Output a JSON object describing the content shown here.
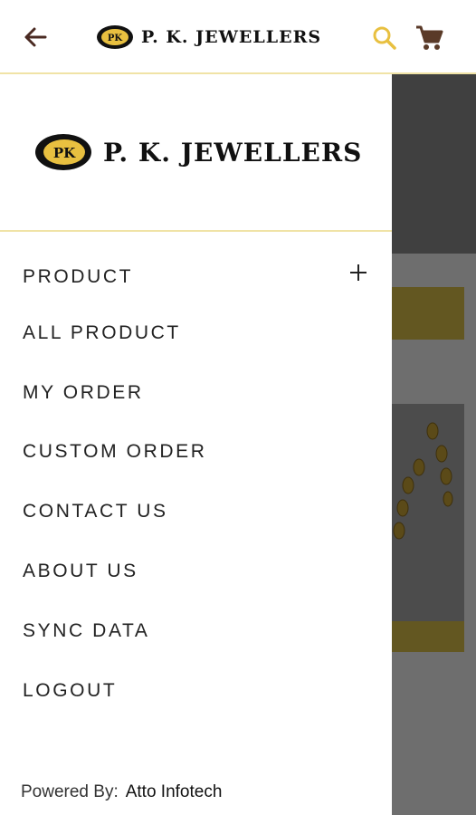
{
  "app": {
    "brand": "P. K. JEWELLERS",
    "emblem_text": "PK"
  },
  "appbar": {
    "back_icon": "arrow-left-icon",
    "search_icon": "search-icon",
    "cart_icon": "cart-icon"
  },
  "drawer": {
    "menu": [
      {
        "label": "PRODUCT",
        "expandable": true
      },
      {
        "label": "ALL PRODUCT"
      },
      {
        "label": "MY ORDER"
      },
      {
        "label": "CUSTOM ORDER"
      },
      {
        "label": "CONTACT US"
      },
      {
        "label": "ABOUT US"
      },
      {
        "label": "SYNC DATA"
      },
      {
        "label": "LOGOUT"
      }
    ],
    "footer": {
      "powered_label": "Powered By:",
      "company": "Atto Infotech"
    }
  },
  "colors": {
    "accent_gold": "#e8c040",
    "divider": "#f0e3a6",
    "cart": "#5a3a28"
  }
}
